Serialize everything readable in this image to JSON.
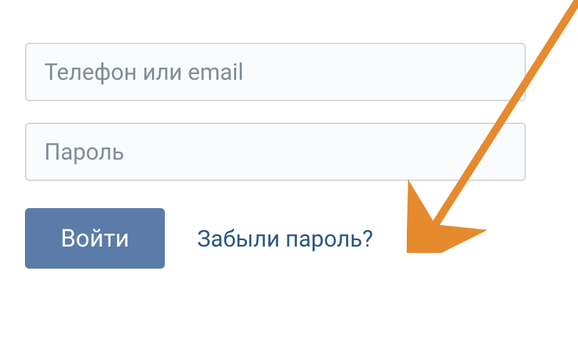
{
  "form": {
    "login_placeholder": "Телефон или email",
    "password_placeholder": "Пароль",
    "submit_label": "Войти",
    "forgot_label": "Забыли пароль?"
  },
  "colors": {
    "button_bg": "#5b7ca8",
    "link": "#2a5885",
    "placeholder": "#818c99",
    "border": "#d3d9de",
    "arrow": "#e68a2e"
  }
}
